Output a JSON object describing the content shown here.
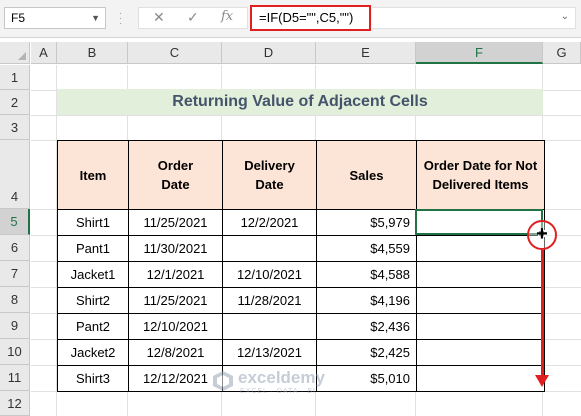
{
  "formula_bar": {
    "name_box": "F5",
    "cancel_symbol": "✕",
    "enter_symbol": "✓",
    "fx_symbol": "fx",
    "formula": "=IF(D5=\"\",C5,\"\")"
  },
  "columns": [
    "A",
    "B",
    "C",
    "D",
    "E",
    "F",
    "G"
  ],
  "selected_column": "F",
  "rows": [
    "1",
    "2",
    "3",
    "4",
    "5",
    "6",
    "7",
    "8",
    "9",
    "10",
    "11",
    "12"
  ],
  "selected_row": "5",
  "title": "Returning Value of Adjacent Cells",
  "table": {
    "headers": {
      "item": "Item",
      "order_date": "Order Date",
      "delivery_date": "Delivery Date",
      "sales": "Sales",
      "result": "Order Date for Not Delivered Items"
    },
    "rows": [
      {
        "item": "Shirt1",
        "order": "11/25/2021",
        "delivery": "12/2/2021",
        "sales": "$5,979",
        "result": ""
      },
      {
        "item": "Pant1",
        "order": "11/30/2021",
        "delivery": "",
        "sales": "$4,559",
        "result": ""
      },
      {
        "item": "Jacket1",
        "order": "12/1/2021",
        "delivery": "12/10/2021",
        "sales": "$4,588",
        "result": ""
      },
      {
        "item": "Shirt2",
        "order": "11/25/2021",
        "delivery": "11/28/2021",
        "sales": "$4,196",
        "result": ""
      },
      {
        "item": "Pant2",
        "order": "12/10/2021",
        "delivery": "",
        "sales": "$2,436",
        "result": ""
      },
      {
        "item": "Jacket2",
        "order": "12/8/2021",
        "delivery": "12/13/2021",
        "sales": "$2,425",
        "result": ""
      },
      {
        "item": "Shirt3",
        "order": "12/12/2021",
        "delivery": "",
        "sales": "$5,010",
        "result": ""
      }
    ]
  },
  "watermark": {
    "name": "exceldemy",
    "tagline": "EXCEL · DATA · BI"
  },
  "colors": {
    "title_bg": "#e2efda",
    "title_text": "#44546a",
    "header_bg": "#fce4d6",
    "selection": "#217346",
    "annotation": "#e02020"
  }
}
